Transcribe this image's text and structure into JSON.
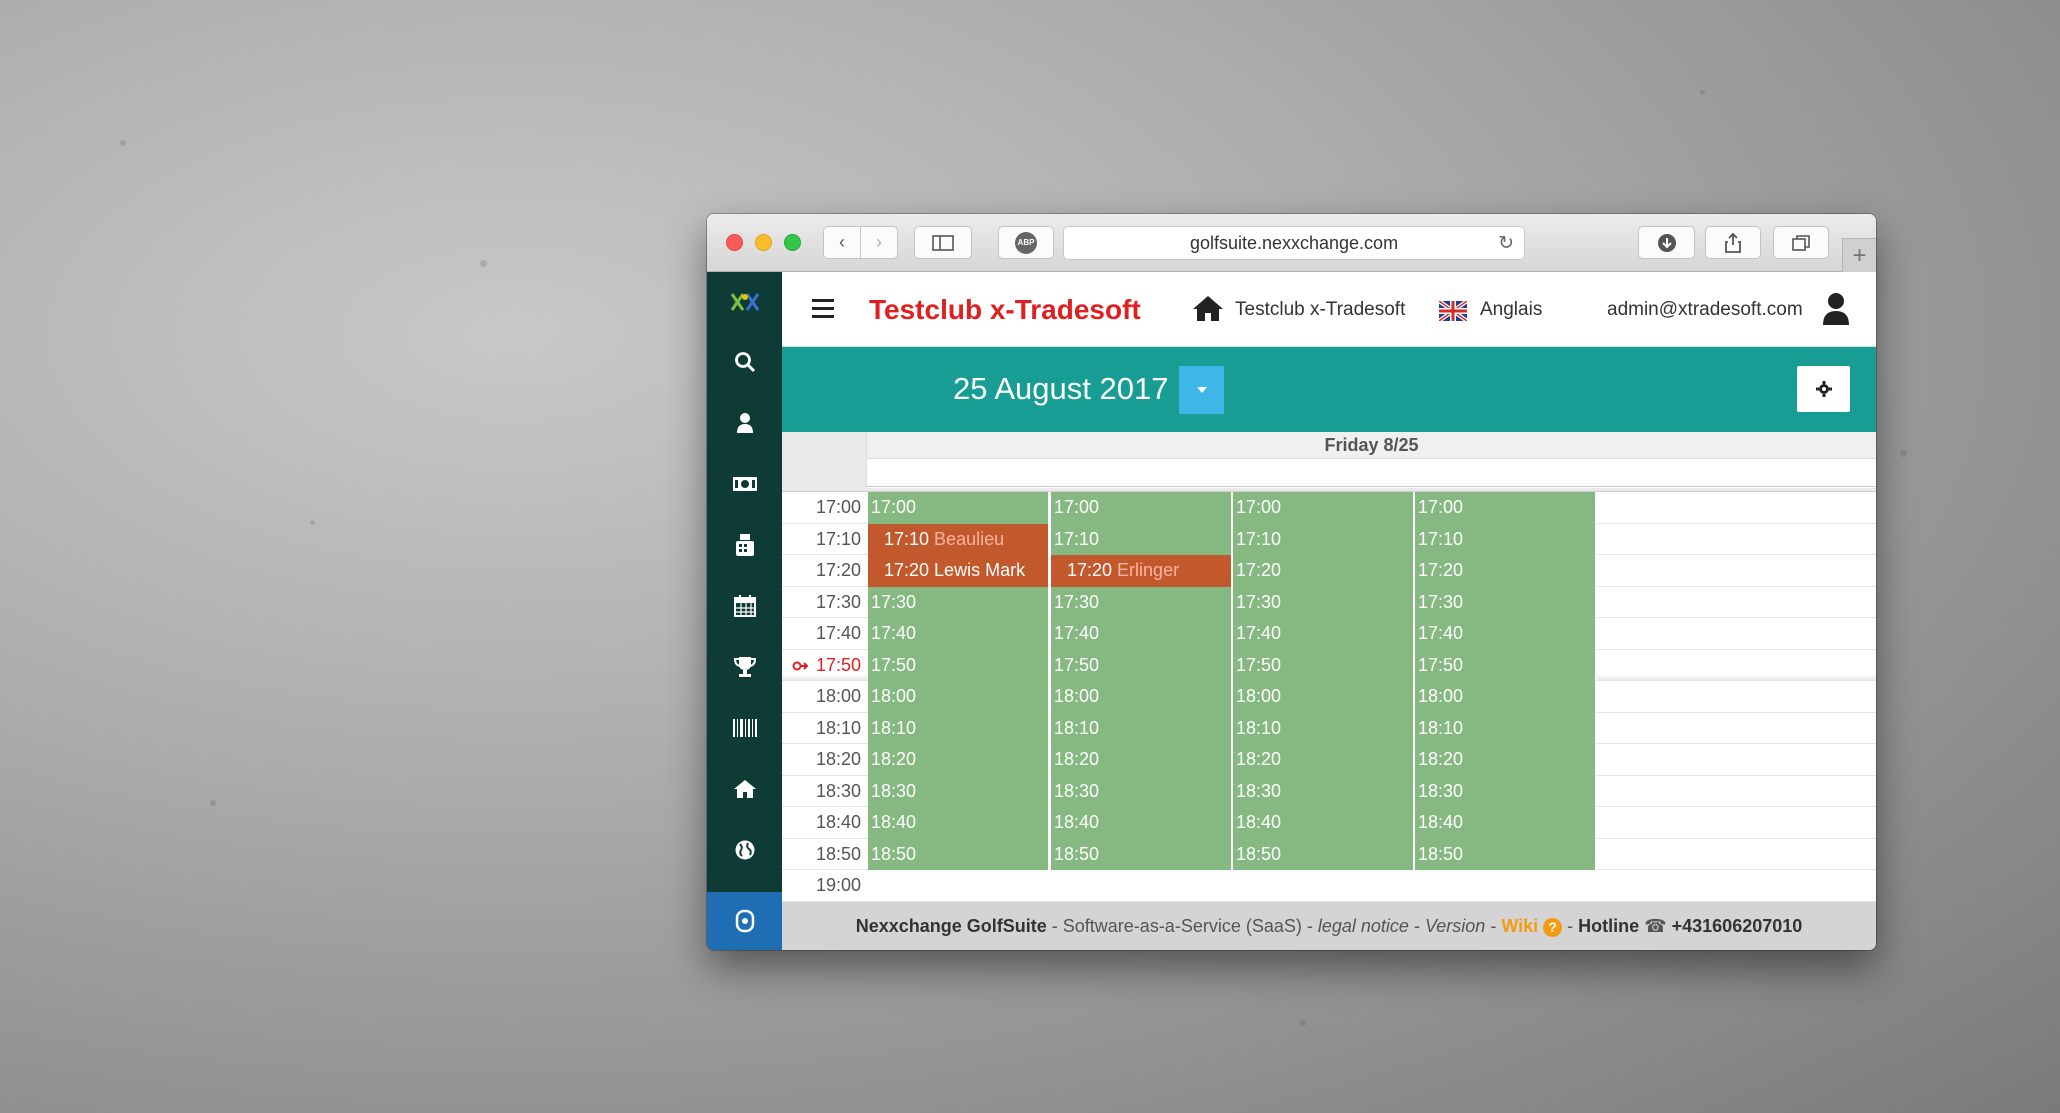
{
  "browser": {
    "url": "golfsuite.nexxchange.com",
    "abp_label": "ABP"
  },
  "header": {
    "club_title": "Testclub x-Tradesoft",
    "home_label": "Testclub x-Tradesoft",
    "language": "Anglais",
    "user_email": "admin@xtradesoft.com"
  },
  "datebar": {
    "date_title": "25 August 2017"
  },
  "calendar": {
    "day_header": "Friday 8/25",
    "current_time": "17:50",
    "rows": [
      {
        "time": "17:00",
        "cells": [
          {
            "t": "17:00"
          },
          {
            "t": "17:00"
          },
          {
            "t": "17:00"
          },
          {
            "t": "17:00"
          }
        ]
      },
      {
        "time": "17:10",
        "cells": [
          {
            "t": "17:10",
            "name": "Beaulieu Philippe",
            "booked": true
          },
          {
            "t": "17:10"
          },
          {
            "t": "17:10"
          },
          {
            "t": "17:10"
          }
        ]
      },
      {
        "time": "17:20",
        "cells": [
          {
            "t": "17:20",
            "name": "Lewis Mark (-)",
            "booked": true,
            "white": true,
            "paid_icon": "€"
          },
          {
            "t": "17:20",
            "name": "Erlinger Rudolf",
            "booked": true
          },
          {
            "t": "17:20"
          },
          {
            "t": "17:20"
          }
        ]
      },
      {
        "time": "17:30",
        "cells": [
          {
            "t": "17:30"
          },
          {
            "t": "17:30"
          },
          {
            "t": "17:30"
          },
          {
            "t": "17:30"
          }
        ]
      },
      {
        "time": "17:40",
        "cells": [
          {
            "t": "17:40"
          },
          {
            "t": "17:40"
          },
          {
            "t": "17:40"
          },
          {
            "t": "17:40"
          }
        ]
      },
      {
        "time": "17:50",
        "now": true,
        "cells": [
          {
            "t": "17:50"
          },
          {
            "t": "17:50"
          },
          {
            "t": "17:50"
          },
          {
            "t": "17:50"
          }
        ]
      },
      {
        "time": "18:00",
        "cells": [
          {
            "t": "18:00"
          },
          {
            "t": "18:00"
          },
          {
            "t": "18:00"
          },
          {
            "t": "18:00"
          }
        ]
      },
      {
        "time": "18:10",
        "cells": [
          {
            "t": "18:10"
          },
          {
            "t": "18:10"
          },
          {
            "t": "18:10"
          },
          {
            "t": "18:10"
          }
        ]
      },
      {
        "time": "18:20",
        "cells": [
          {
            "t": "18:20"
          },
          {
            "t": "18:20"
          },
          {
            "t": "18:20"
          },
          {
            "t": "18:20"
          }
        ]
      },
      {
        "time": "18:30",
        "cells": [
          {
            "t": "18:30"
          },
          {
            "t": "18:30"
          },
          {
            "t": "18:30"
          },
          {
            "t": "18:30"
          }
        ]
      },
      {
        "time": "18:40",
        "cells": [
          {
            "t": "18:40"
          },
          {
            "t": "18:40"
          },
          {
            "t": "18:40"
          },
          {
            "t": "18:40"
          }
        ]
      },
      {
        "time": "18:50",
        "cells": [
          {
            "t": "18:50"
          },
          {
            "t": "18:50"
          },
          {
            "t": "18:50"
          },
          {
            "t": "18:50"
          }
        ]
      },
      {
        "time": "19:00",
        "cells": []
      }
    ]
  },
  "footer": {
    "brand": "Nexxchange GolfSuite",
    "saas": " - Software-as-a-Service (SaaS) - ",
    "legal": "legal notice",
    "dash1": " - ",
    "version": "Version",
    "dash2": " - ",
    "wiki": "Wiki",
    "dash3": " - ",
    "hotline_label": "Hotline",
    "hotline_number": "+431606207010"
  },
  "sidebar": {
    "icons": [
      "search-icon",
      "user-icon",
      "money-icon",
      "cash-register-icon",
      "calendar-icon",
      "trophy-icon",
      "barcode-icon",
      "home-icon",
      "globe-icon",
      "support-icon"
    ]
  },
  "colors": {
    "sidebar": "#0f3b36",
    "teal": "#179d93",
    "free_slot": "#86b882",
    "booked_slot": "#c2592d",
    "title_red": "#e02020"
  }
}
